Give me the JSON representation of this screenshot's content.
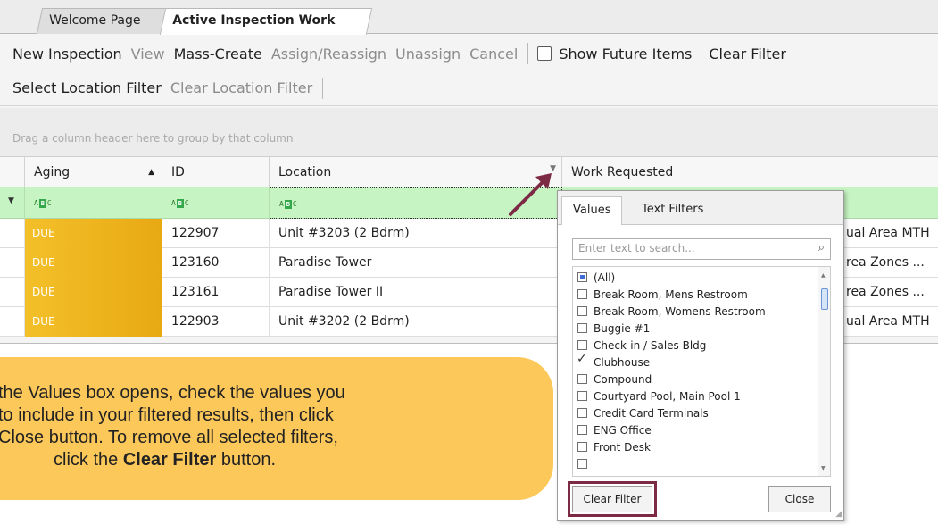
{
  "tabs": [
    "Welcome Page",
    "Active Inspection Work"
  ],
  "toolbar1": {
    "items": [
      {
        "label": "New Inspection",
        "enabled": true
      },
      {
        "label": "View",
        "enabled": false
      },
      {
        "label": "Mass-Create",
        "enabled": true
      },
      {
        "label": "Assign/Reassign",
        "enabled": false
      },
      {
        "label": "Unassign",
        "enabled": false
      },
      {
        "label": "Cancel",
        "enabled": false
      }
    ],
    "show_future_label": "Show Future Items",
    "show_future_checked": false,
    "clear_filter_label": "Clear Filter"
  },
  "toolbar2": {
    "select_location_label": "Select Location Filter",
    "clear_location_label": "Clear Location Filter"
  },
  "group_panel_text": "Drag a column header here to group by that column",
  "columns": [
    "Aging",
    "ID",
    "Location",
    "Work Requested"
  ],
  "rows": [
    {
      "aging": "DUE",
      "id": "122907",
      "location": "Unit #3203 (2 Bdrm)",
      "work": "ual Area MTH"
    },
    {
      "aging": "DUE",
      "id": "123160",
      "location": "Paradise Tower",
      "work": "rea Zones ..."
    },
    {
      "aging": "DUE",
      "id": "123161",
      "location": "Paradise Tower II",
      "work": "rea Zones ..."
    },
    {
      "aging": "DUE",
      "id": "122903",
      "location": "Unit #3202 (2 Bdrm)",
      "work": "ual Area MTH"
    }
  ],
  "filter_popup": {
    "tabs": [
      "Values",
      "Text Filters"
    ],
    "search_placeholder": "Enter text to search...",
    "items": [
      {
        "label": "(All)",
        "state": "indeterminate"
      },
      {
        "label": "Break Room, Mens Restroom",
        "state": "unchecked"
      },
      {
        "label": "Break Room, Womens Restroom",
        "state": "unchecked"
      },
      {
        "label": "Buggie #1",
        "state": "unchecked"
      },
      {
        "label": "Check-in / Sales Bldg",
        "state": "unchecked"
      },
      {
        "label": "Clubhouse",
        "state": "checked"
      },
      {
        "label": "Compound",
        "state": "unchecked"
      },
      {
        "label": "Courtyard Pool, Main Pool 1",
        "state": "unchecked"
      },
      {
        "label": "Credit Card Terminals",
        "state": "unchecked"
      },
      {
        "label": "ENG Office",
        "state": "unchecked"
      },
      {
        "label": "Front Desk",
        "state": "unchecked"
      }
    ],
    "clear_filter_label": "Clear Filter",
    "close_label": "Close"
  },
  "callout": {
    "lines": [
      "the Values box opens, check the values you",
      "to include in your filtered results, then click",
      "Close button. To remove all selected filters,"
    ],
    "last_line_prefix": "click the ",
    "last_line_bold": "Clear Filter",
    "last_line_suffix": " button."
  },
  "colors": {
    "due_gradient": "#f3c02a",
    "filter_row": "#c6f4c2",
    "callout_bg": "#fdc85a",
    "highlight_border": "#7d2a45"
  }
}
